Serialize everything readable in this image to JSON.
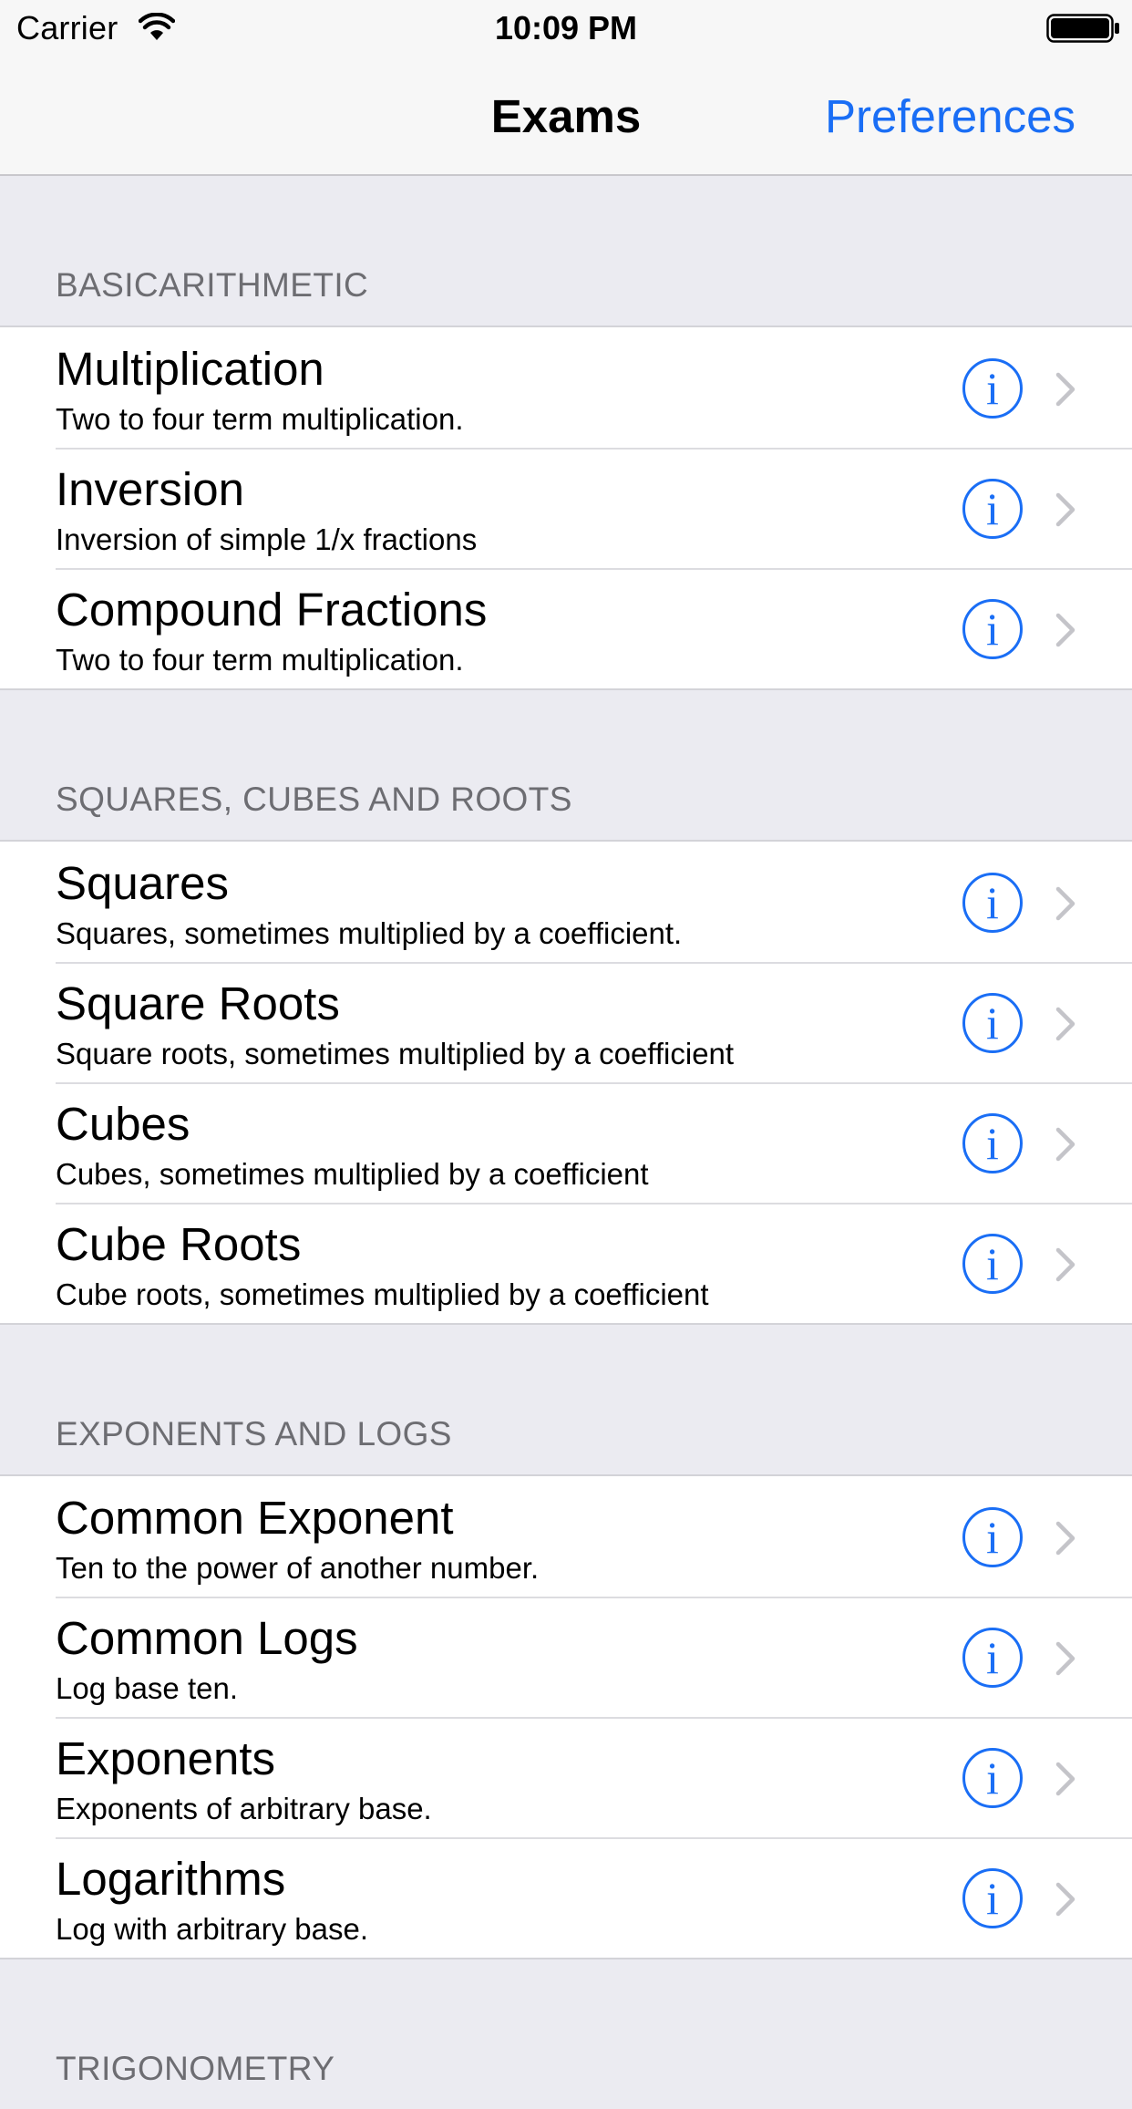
{
  "status_bar": {
    "carrier": "Carrier",
    "time": "10:09 PM"
  },
  "nav": {
    "title": "Exams",
    "action_label": "Preferences"
  },
  "accent_color": "#1a6ef5",
  "sections": [
    {
      "header": "BASICARITHMETIC",
      "items": [
        {
          "title": "Multiplication",
          "subtitle": "Two to four term multiplication."
        },
        {
          "title": "Inversion",
          "subtitle": "Inversion of simple 1/x fractions"
        },
        {
          "title": "Compound Fractions",
          "subtitle": "Two to four term multiplication."
        }
      ]
    },
    {
      "header": "SQUARES, CUBES AND ROOTS",
      "items": [
        {
          "title": "Squares",
          "subtitle": "Squares, sometimes multiplied by a coefficient."
        },
        {
          "title": "Square Roots",
          "subtitle": "Square roots, sometimes multiplied by a coefficient"
        },
        {
          "title": "Cubes",
          "subtitle": "Cubes, sometimes multiplied by a coefficient"
        },
        {
          "title": "Cube Roots",
          "subtitle": "Cube roots, sometimes multiplied by a coefficient"
        }
      ]
    },
    {
      "header": "EXPONENTS AND LOGS",
      "items": [
        {
          "title": "Common Exponent",
          "subtitle": "Ten to the power of another number."
        },
        {
          "title": "Common Logs",
          "subtitle": "Log base ten."
        },
        {
          "title": "Exponents",
          "subtitle": "Exponents of arbitrary base."
        },
        {
          "title": "Logarithms",
          "subtitle": "Log with arbitrary base."
        }
      ]
    },
    {
      "header": "TRIGONOMETRY",
      "items": []
    }
  ],
  "icons": {
    "info": "info-circle-icon",
    "chevron": "chevron-right-icon",
    "info_glyph": "i"
  }
}
